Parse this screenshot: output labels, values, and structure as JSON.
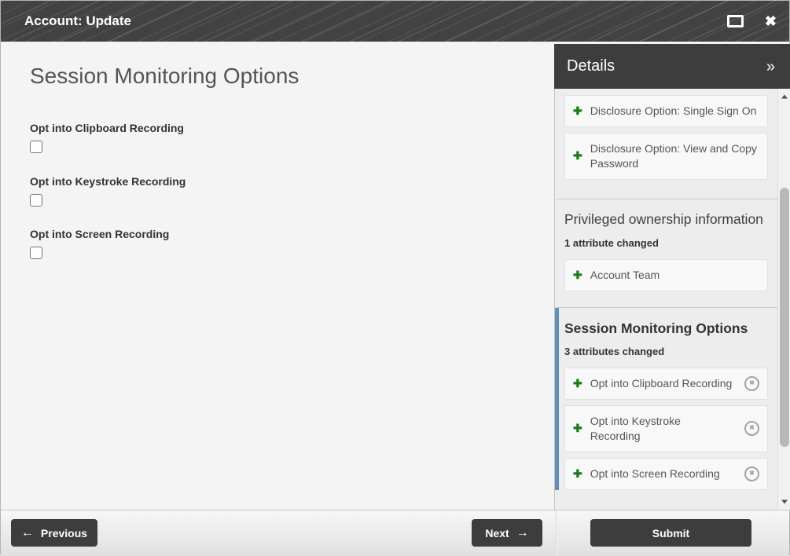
{
  "window": {
    "title": "Account: Update"
  },
  "main": {
    "heading": "Session Monitoring Options",
    "fields": [
      {
        "label": "Opt into Clipboard Recording",
        "checked": false
      },
      {
        "label": "Opt into Keystroke Recording",
        "checked": false
      },
      {
        "label": "Opt into Screen Recording",
        "checked": false
      }
    ]
  },
  "details": {
    "title": "Details",
    "collapse_icon": "»",
    "sections": [
      {
        "heading": "",
        "items": [
          {
            "label": "Disclosure Option: Single Sign On"
          },
          {
            "label": "Disclosure Option: View and Copy Password"
          }
        ]
      },
      {
        "heading": "Privileged ownership information",
        "changed_summary": "1 attribute changed",
        "items": [
          {
            "label": "Account Team"
          }
        ]
      },
      {
        "heading": "Session Monitoring Options",
        "changed_summary": "3 attributes changed",
        "active": true,
        "items": [
          {
            "label": "Opt into Clipboard Recording",
            "removable": true
          },
          {
            "label": "Opt into Keystroke Recording",
            "removable": true
          },
          {
            "label": "Opt into Screen Recording",
            "removable": true
          }
        ]
      }
    ]
  },
  "footer": {
    "previous_label": "Previous",
    "next_label": "Next",
    "submit_label": "Submit"
  },
  "icons": {
    "plus": "✚",
    "remove": "✖",
    "close": "✖",
    "left_arrow": "←",
    "right_arrow": "→"
  },
  "colors": {
    "titlebar_bg": "#424242",
    "details_header_bg": "#3d3d3d",
    "accent_green": "#1c7c1c",
    "active_section_blue": "#6190ba",
    "button_bg": "#3d3d3d",
    "page_bg": "#f4f4f4",
    "sidebar_bg": "#ededed"
  }
}
